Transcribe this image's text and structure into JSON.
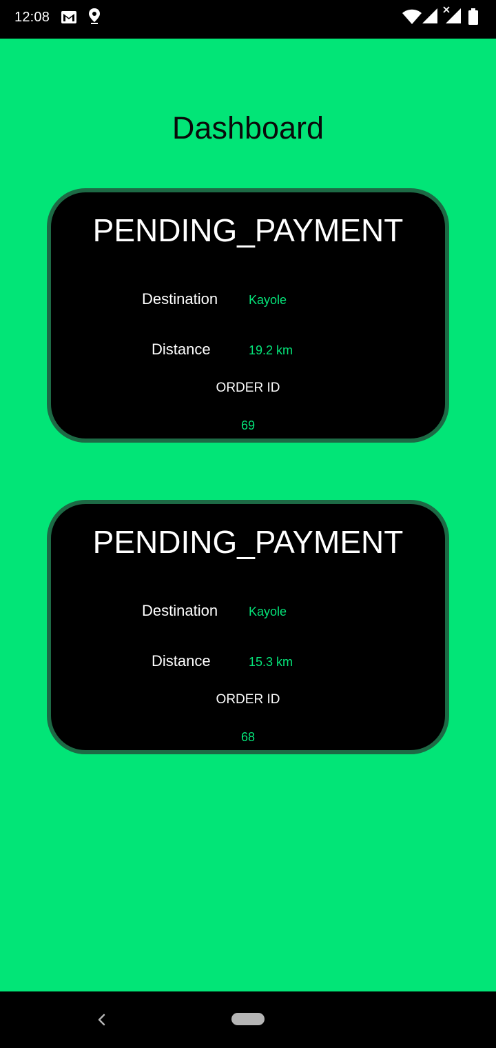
{
  "status_bar": {
    "time": "12:08",
    "icons": [
      "gmail-icon",
      "location-pin-icon",
      "wifi-icon",
      "cell-signal-icon",
      "no-data-x-icon",
      "cell-signal-2-icon",
      "battery-icon"
    ]
  },
  "header": {
    "title": "Dashboard"
  },
  "orders": [
    {
      "status": "PENDING_PAYMENT",
      "destination_label": "Destination",
      "destination_value": "Kayole",
      "distance_label": "Distance",
      "distance_value": "19.2 km",
      "order_id_label": "ORDER ID",
      "order_id_value": "69"
    },
    {
      "status": "PENDING_PAYMENT",
      "destination_label": "Destination",
      "destination_value": "Kayole",
      "distance_label": "Distance",
      "distance_value": "15.3 km",
      "order_id_label": "ORDER ID",
      "order_id_value": "68"
    }
  ],
  "nav_bar": {
    "icons": [
      "back-icon",
      "home-pill-icon"
    ]
  },
  "colors": {
    "background": "#02e577",
    "card": "#000000",
    "card_border": "#1d6a45",
    "value_text": "#05e57a",
    "label_text": "#ffffff"
  }
}
